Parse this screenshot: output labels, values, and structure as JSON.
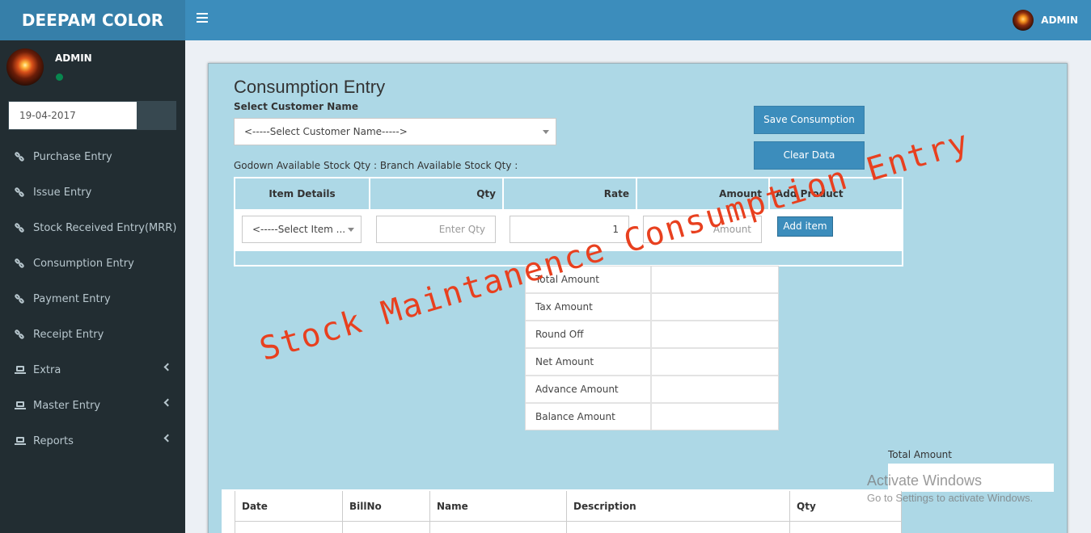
{
  "app": {
    "brand": "DEEPAM COLOR",
    "user": "ADMIN"
  },
  "sidebar": {
    "user_name": "ADMIN",
    "date": "19-04-2017",
    "items": [
      {
        "label": "Purchase Entry",
        "icon": "link-icon"
      },
      {
        "label": "Issue Entry",
        "icon": "link-icon"
      },
      {
        "label": "Stock Received Entry(MRR)",
        "icon": "link-icon"
      },
      {
        "label": "Consumption Entry",
        "icon": "link-icon"
      },
      {
        "label": "Payment Entry",
        "icon": "link-icon"
      },
      {
        "label": "Receipt Entry",
        "icon": "link-icon"
      },
      {
        "label": "Extra",
        "icon": "laptop-icon",
        "expandable": true
      },
      {
        "label": "Master Entry",
        "icon": "laptop-icon",
        "expandable": true
      },
      {
        "label": "Reports",
        "icon": "laptop-icon",
        "expandable": true
      }
    ]
  },
  "form": {
    "title": "Consumption Entry",
    "customer_label": "Select Customer Name",
    "customer_select": "<-----Select Customer Name----->",
    "save_button": "Save Consumption",
    "clear_button": "Clear Data",
    "stock_line": "Godown Available Stock Qty : Branch Available Stock Qty :",
    "item_table": {
      "headers": [
        "Item Details",
        "Qty",
        "Rate",
        "Amount",
        "Add Product"
      ],
      "item_select": "<-----Select Item ...",
      "qty_placeholder": "Enter Qty",
      "rate_value": "1",
      "amount_placeholder": "Amount",
      "add_button": "Add item"
    },
    "summary": [
      {
        "label": "Total Amount",
        "value": ""
      },
      {
        "label": "Tax Amount",
        "value": ""
      },
      {
        "label": "Round Off",
        "value": ""
      },
      {
        "label": "Net Amount",
        "value": ""
      },
      {
        "label": "Advance Amount",
        "value": ""
      },
      {
        "label": "Balance Amount",
        "value": ""
      }
    ],
    "total_amount_label": "Total Amount",
    "bill_table": {
      "headers": [
        "Date",
        "BillNo",
        "Name",
        "Description",
        "Qty"
      ]
    }
  },
  "watermark": "Stock Maintanence Consumption Entry",
  "windows_notice": {
    "line1": "Activate Windows",
    "line2": "Go to Settings to activate Windows."
  },
  "colors": {
    "header": "#3c8dbc",
    "logo": "#367fa9",
    "sidebar": "#222d32",
    "content": "#add8e6",
    "watermark": "#e8401f"
  }
}
